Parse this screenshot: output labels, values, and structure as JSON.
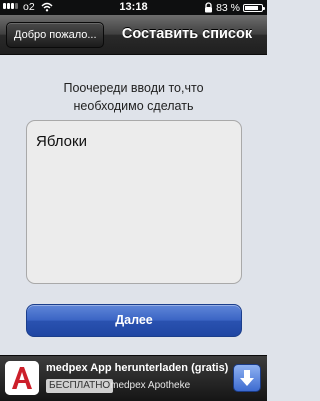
{
  "status_bar": {
    "carrier": "o2",
    "time": "13:18",
    "battery": "83 %",
    "battery_level": 0.83
  },
  "navbar": {
    "back_label": "Добро пожало...",
    "title": "Составить список"
  },
  "content": {
    "instruction_line1": "Поочереди вводи то,что",
    "instruction_line2": "необходимо сделать",
    "textarea_value": "Яблоки",
    "next_label": "Далее"
  },
  "ad": {
    "title": "medpex App herunterladen (gratis)",
    "badge": "БЕСПЛАТНО",
    "subtitle": "- medpex Apotheke",
    "icon": "medpex-pharmacy-logo-icon",
    "download_icon": "download-arrow-icon",
    "accent": "#cc1f2a"
  },
  "colors": {
    "background": "#dfe3ea",
    "button_blue": "#2a52b0"
  }
}
